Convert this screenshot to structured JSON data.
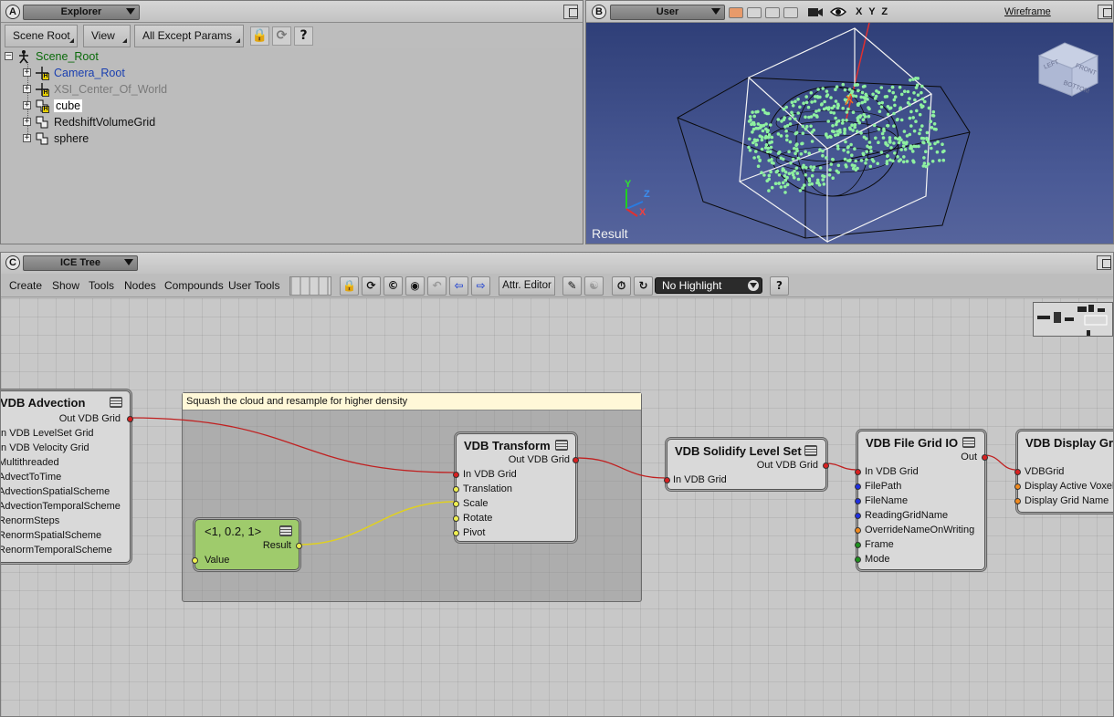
{
  "explorer": {
    "badge": "A",
    "title": "Explorer",
    "toolbar": {
      "scene_root": "Scene Root",
      "view": "View",
      "filter": "All Except Params",
      "help": "?"
    },
    "tree": [
      {
        "label": "Scene_Root"
      },
      {
        "label": "Camera_Root"
      },
      {
        "label": "XSI_Center_Of_World"
      },
      {
        "label": "cube"
      },
      {
        "label": "RedshiftVolumeGrid"
      },
      {
        "label": "sphere"
      }
    ]
  },
  "viewport": {
    "badge": "B",
    "camera": "User",
    "axes_toggle": "X Y Z",
    "display_mode": "Wireframe",
    "caption": "Result",
    "gizmo": {
      "y": "Y",
      "z": "Z",
      "x": "X"
    },
    "cube_faces": {
      "left": "LEFT",
      "front": "FRONT",
      "bottom": "BOTTOM"
    }
  },
  "icetree": {
    "badge": "C",
    "title": "ICE Tree",
    "menu": [
      "Create",
      "Show",
      "Tools",
      "Nodes",
      "Compounds",
      "User Tools"
    ],
    "attr_editor": "Attr. Editor",
    "highlight": "No Highlight",
    "help": "?",
    "comment": "Squash the cloud and resample for higher density",
    "nodes": {
      "advection": {
        "title": "VDB Advection",
        "out": "Out VDB Grid",
        "ports": [
          "In VDB LevelSet Grid",
          "In VDB Velocity Grid",
          "Multithreaded",
          "AdvectToTime",
          "AdvectionSpatialScheme",
          "AdvectionTemporalScheme",
          "RenormSteps",
          "RenormSpatialScheme",
          "RenormTemporalScheme"
        ]
      },
      "vector": {
        "title": "<1, 0.2, 1>",
        "out": "Result",
        "in": "Value"
      },
      "transform": {
        "title": "VDB Transform",
        "out": "Out VDB Grid",
        "ports": [
          "In VDB Grid",
          "Translation",
          "Scale",
          "Rotate",
          "Pivot"
        ]
      },
      "solidify": {
        "title": "VDB Solidify Level Set",
        "out": "Out VDB Grid",
        "in": "In VDB Grid"
      },
      "fileio": {
        "title": "VDB File Grid IO",
        "out": "Out",
        "ports": [
          "In VDB Grid",
          "FilePath",
          "FileName",
          "ReadingGridName",
          "OverrideNameOnWriting",
          "Frame",
          "Mode"
        ]
      },
      "display": {
        "title": "VDB Display Grid",
        "ports": [
          "VDBGrid",
          "Display Active Voxels",
          "Display Grid Name"
        ]
      }
    }
  }
}
